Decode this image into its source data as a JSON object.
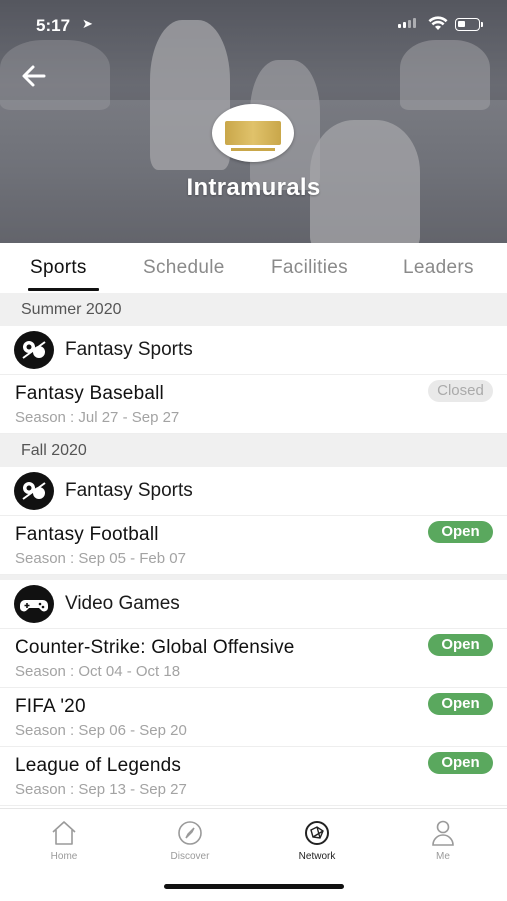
{
  "status_bar": {
    "time": "5:17",
    "location_icon": "location-arrow-icon"
  },
  "header": {
    "title": "Intramurals",
    "back_icon": "back-arrow-icon"
  },
  "tabs": [
    {
      "label": "Sports",
      "active": true
    },
    {
      "label": "Schedule",
      "active": false
    },
    {
      "label": "Facilities",
      "active": false
    },
    {
      "label": "Leaders",
      "active": false
    }
  ],
  "sections": [
    {
      "title": "Summer 2020",
      "groups": [
        {
          "category": "Fantasy Sports",
          "icon": "fantasy-sports-icon",
          "items": [
            {
              "name": "Fantasy Baseball",
              "season": "Season : Jul 27 - Sep 27",
              "status": "Closed"
            }
          ]
        }
      ]
    },
    {
      "title": "Fall 2020",
      "groups": [
        {
          "category": "Fantasy Sports",
          "icon": "fantasy-sports-icon",
          "items": [
            {
              "name": "Fantasy Football",
              "season": "Season : Sep 05 - Feb 07",
              "status": "Open"
            }
          ]
        },
        {
          "category": "Video Games",
          "icon": "video-games-icon",
          "items": [
            {
              "name": "Counter-Strike: Global Offensive",
              "season": "Season : Oct 04 - Oct 18",
              "status": "Open"
            },
            {
              "name": "FIFA '20",
              "season": "Season : Sep 06 - Sep 20",
              "status": "Open"
            },
            {
              "name": "League of Legends",
              "season": "Season : Sep 13 - Sep 27",
              "status": "Open"
            }
          ]
        }
      ]
    }
  ],
  "bottom_nav": [
    {
      "label": "Home",
      "icon": "home-icon",
      "active": false
    },
    {
      "label": "Discover",
      "icon": "compass-icon",
      "active": false
    },
    {
      "label": "Network",
      "icon": "network-icon",
      "active": true
    },
    {
      "label": "Me",
      "icon": "person-icon",
      "active": false
    }
  ],
  "colors": {
    "open_badge": "#5aa85e",
    "closed_badge": "#e9e9e9",
    "logo_gold": "#c9a74a"
  }
}
